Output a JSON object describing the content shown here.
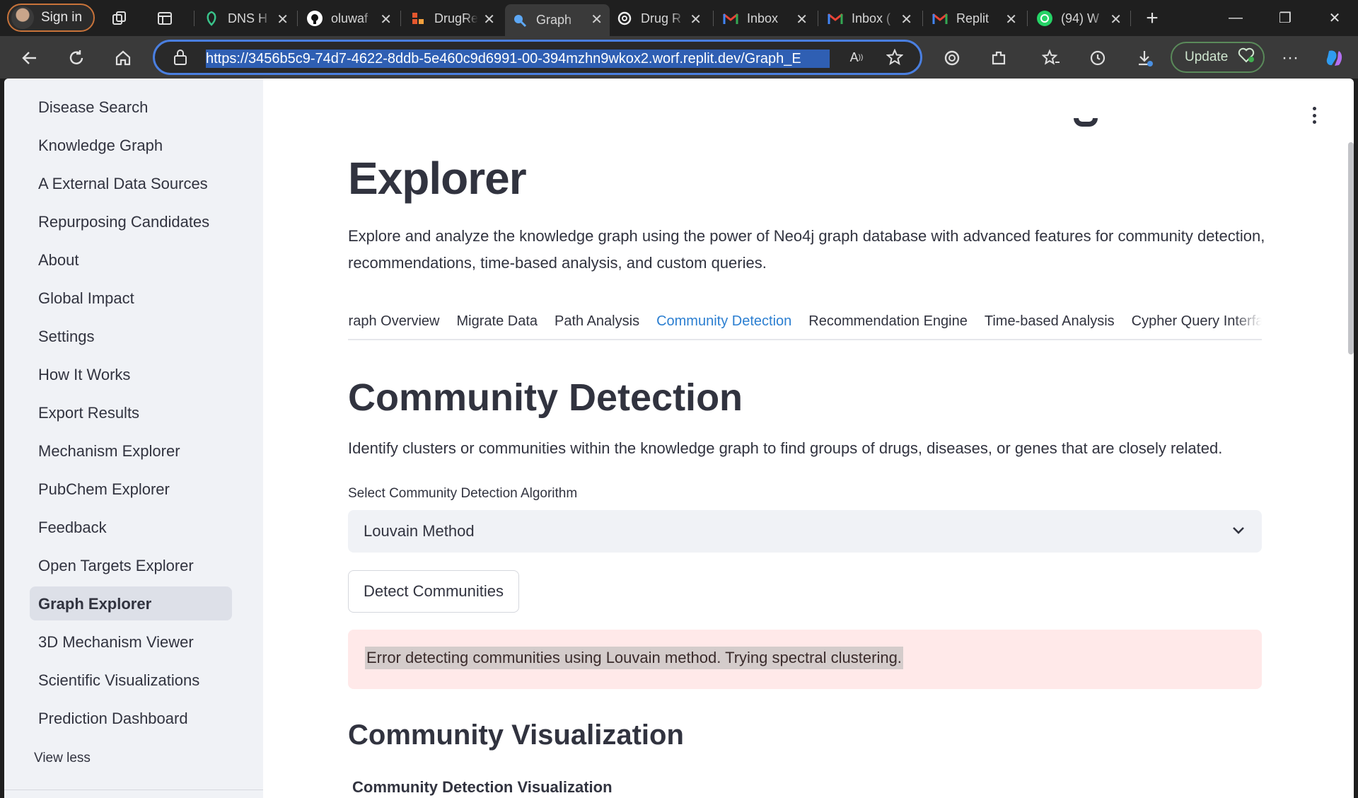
{
  "browser": {
    "signin_label": "Sign in",
    "tabs": [
      {
        "title": "DNS H",
        "icon": "dns-icon"
      },
      {
        "title": "oluwaf",
        "icon": "github-icon"
      },
      {
        "title": "DrugRe",
        "icon": "drugrepurpose-icon"
      },
      {
        "title": "Graph",
        "icon": "search-icon"
      },
      {
        "title": "Drug R",
        "icon": "openai-icon"
      },
      {
        "title": "Inbox",
        "icon": "gmail-icon"
      },
      {
        "title": "Inbox (",
        "icon": "gmail-icon"
      },
      {
        "title": "Replit",
        "icon": "gmail-icon"
      },
      {
        "title": "(94) W",
        "icon": "whatsapp-icon"
      }
    ],
    "url": "https://3456b5c9-74d7-4622-8ddb-5e460c9d6991-00-394mzhn9wkox2.worf.replit.dev/Graph_E",
    "update_label": "Update"
  },
  "sidebar": {
    "items": [
      "Disease Search",
      "Knowledge Graph",
      "A External Data Sources",
      "Repurposing Candidates",
      "About",
      "Global Impact",
      "Settings",
      "How It Works",
      "Export Results",
      "Mechanism Explorer",
      "PubChem Explorer",
      "Feedback",
      "Open Targets Explorer",
      "Graph Explorer",
      "3D Mechanism Viewer",
      "Scientific Visualizations",
      "Prediction Dashboard"
    ],
    "active": "Graph Explorer",
    "view_less": "View less"
  },
  "main": {
    "heading_visible": "Explorer",
    "intro": "Explore and analyze the knowledge graph using the power of Neo4j graph database with advanced features for community detection, recommendations, time-based analysis, and custom queries.",
    "tabs": [
      "Graph Overview",
      "Migrate Data",
      "Path Analysis",
      "Community Detection",
      "Recommendation Engine",
      "Time-based Analysis",
      "Cypher Query Interface"
    ],
    "active_tab": "Community Detection",
    "section_title": "Community Detection",
    "section_desc": "Identify clusters or communities within the knowledge graph to find groups of drugs, diseases, or genes that are closely related.",
    "select_label": "Select Community Detection Algorithm",
    "select_value": "Louvain Method",
    "detect_button": "Detect Communities",
    "error_text": "Error detecting communities using Louvain method. Trying spectral clustering.",
    "viz_title": "Community Visualization",
    "viz_subtitle": "Community Detection Visualization"
  },
  "colors": {
    "accent": "#2c7fd1",
    "sidebar_bg": "#f0f2f6",
    "error_bg": "#ffe9e9",
    "text": "#31333f"
  }
}
